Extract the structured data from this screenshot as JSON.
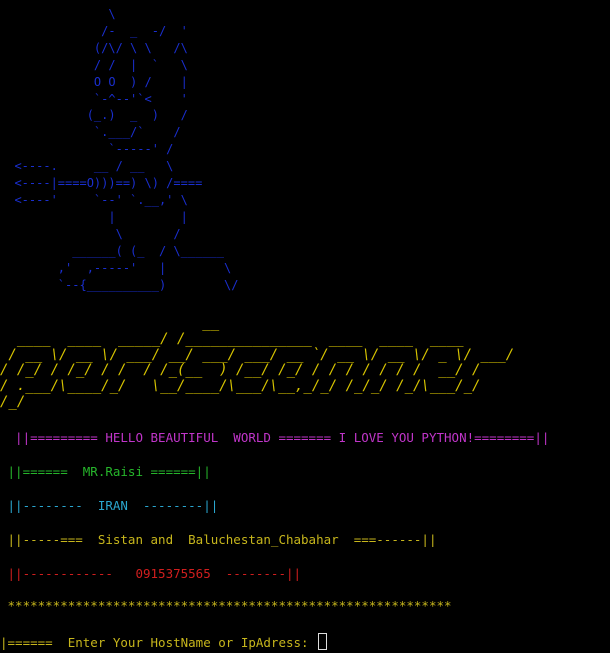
{
  "ascii_art": "               \\\n              /-  _  -/  '\n             (/\\/ \\ \\   /\\\n             / /  |  `   \\\n             O O  ) /    |\n             `-^--'`<    '\n            (_.)  _  )   /\n             `.___/`    /\n               `-----' /\n  <----.     __ / __   \\\n  <----|====O)))==) \\) /====\n  <----'     `--' `.__,' \\\n               |         |\n                \\       /\n          ______( (_  / \\______\n        ,'  ,-----'   |        \\\n        `--{__________)        \\/",
  "banner": "                        __\n  ____  ____  _____/ /_______________  ____  ____  ____\n / __ \\/ __ \\/ ___/ __/ ___/ ___/ __ `/ __ \\/ __ \\/ _ \\/ ___/\n/ /_/ / /_/ / /  / /_(__  ) /__/ /_/ / / / / / / /  __/ /\n/ .___/\\____/_/   \\__/____/\\___/\\__,_/_/ /_/_/ /_/\\___/_/\n/_/",
  "lines": {
    "hello": "  ||========= HELLO BEAUTIFUL  WORLD ======= I LOVE YOU PYTHON!========||",
    "name": " ||======  MR.Raisi ======||",
    "country": " ||--------  IRAN  --------||",
    "region": " ||-----===  Sistan and  Baluchestan_Chabahar  ===------||",
    "phone": " ||------------   0915375565  --------||",
    "stars": " ***********************************************************"
  },
  "prompt": {
    "text": "|======  Enter Your HostName or IpAdress: "
  },
  "colors": {
    "background": "#000000",
    "art": "#1a2fd0",
    "banner": "#d7c400",
    "hello": "#c035c9",
    "name": "#26b62b",
    "country": "#2aa6cf",
    "region": "#c7b61c",
    "phone": "#d01e1e"
  }
}
